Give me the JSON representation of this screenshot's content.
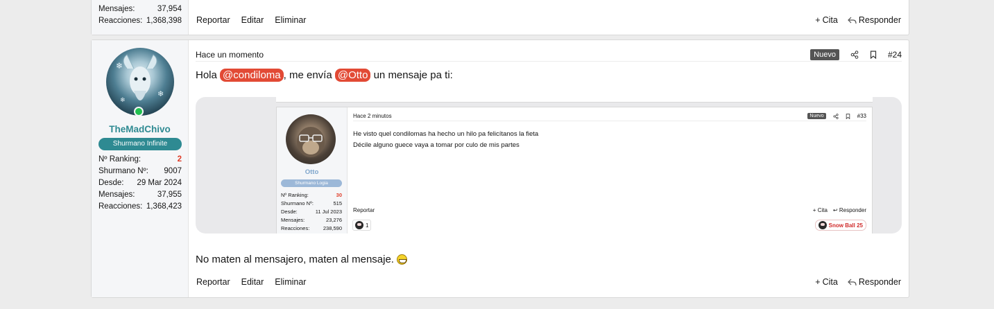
{
  "prev_post": {
    "stats": [
      {
        "label": "Mensajes:",
        "value": "37,954"
      },
      {
        "label": "Reacciones:",
        "value": "1,368,398"
      }
    ],
    "actions": {
      "report": "Reportar",
      "edit": "Editar",
      "delete": "Eliminar",
      "quote": "Cita",
      "reply": "Responder"
    }
  },
  "post": {
    "user": {
      "name": "TheMadChivo",
      "title": "Shurmano Infinite",
      "stats": [
        {
          "label": "Nº Ranking:",
          "value": "2"
        },
        {
          "label": "Shurmano Nº:",
          "value": "9007"
        },
        {
          "label": "Desde:",
          "value": "29 Mar 2024"
        },
        {
          "label": "Mensajes:",
          "value": "37,955"
        },
        {
          "label": "Reacciones:",
          "value": "1,368,423"
        }
      ]
    },
    "time": "Hace un momento",
    "badge": "Nuevo",
    "number": "#24",
    "message": {
      "prefix": "Hola ",
      "mention1": "@condiloma",
      "middle": ", me envía ",
      "mention2": "@Otto",
      "suffix": " un mensaje pa ti:"
    },
    "closing": "No maten al mensajero, maten al mensaje.",
    "actions": {
      "report": "Reportar",
      "edit": "Editar",
      "delete": "Eliminar",
      "quote": "Cita",
      "reply": "Responder"
    }
  },
  "embedded": {
    "user": {
      "name": "Otto",
      "title": "Shurmano Logia",
      "stats": [
        {
          "label": "Nº Ranking:",
          "value": "30"
        },
        {
          "label": "Shurmano Nº:",
          "value": "515"
        },
        {
          "label": "Desde:",
          "value": "11 Jul 2023"
        },
        {
          "label": "Mensajes:",
          "value": "23,276"
        },
        {
          "label": "Reacciones:",
          "value": "238,590"
        }
      ]
    },
    "time": "Hace 2 minutos",
    "badge": "Nuevo",
    "number": "#33",
    "lines": [
      "He visto quel condilomas ha hecho un hilo pa felicítanos la fieta",
      "Décile alguno guece vaya a tomar por culo de mis partes"
    ],
    "actions": {
      "report": "Reportar",
      "quote": "Cita",
      "reply": "Responder"
    },
    "reaction_count": "1",
    "snowball": "Snow Ball 25"
  },
  "colors": {
    "accent": "#2e8a92",
    "mention": "#e24a35",
    "online": "#21c050"
  }
}
